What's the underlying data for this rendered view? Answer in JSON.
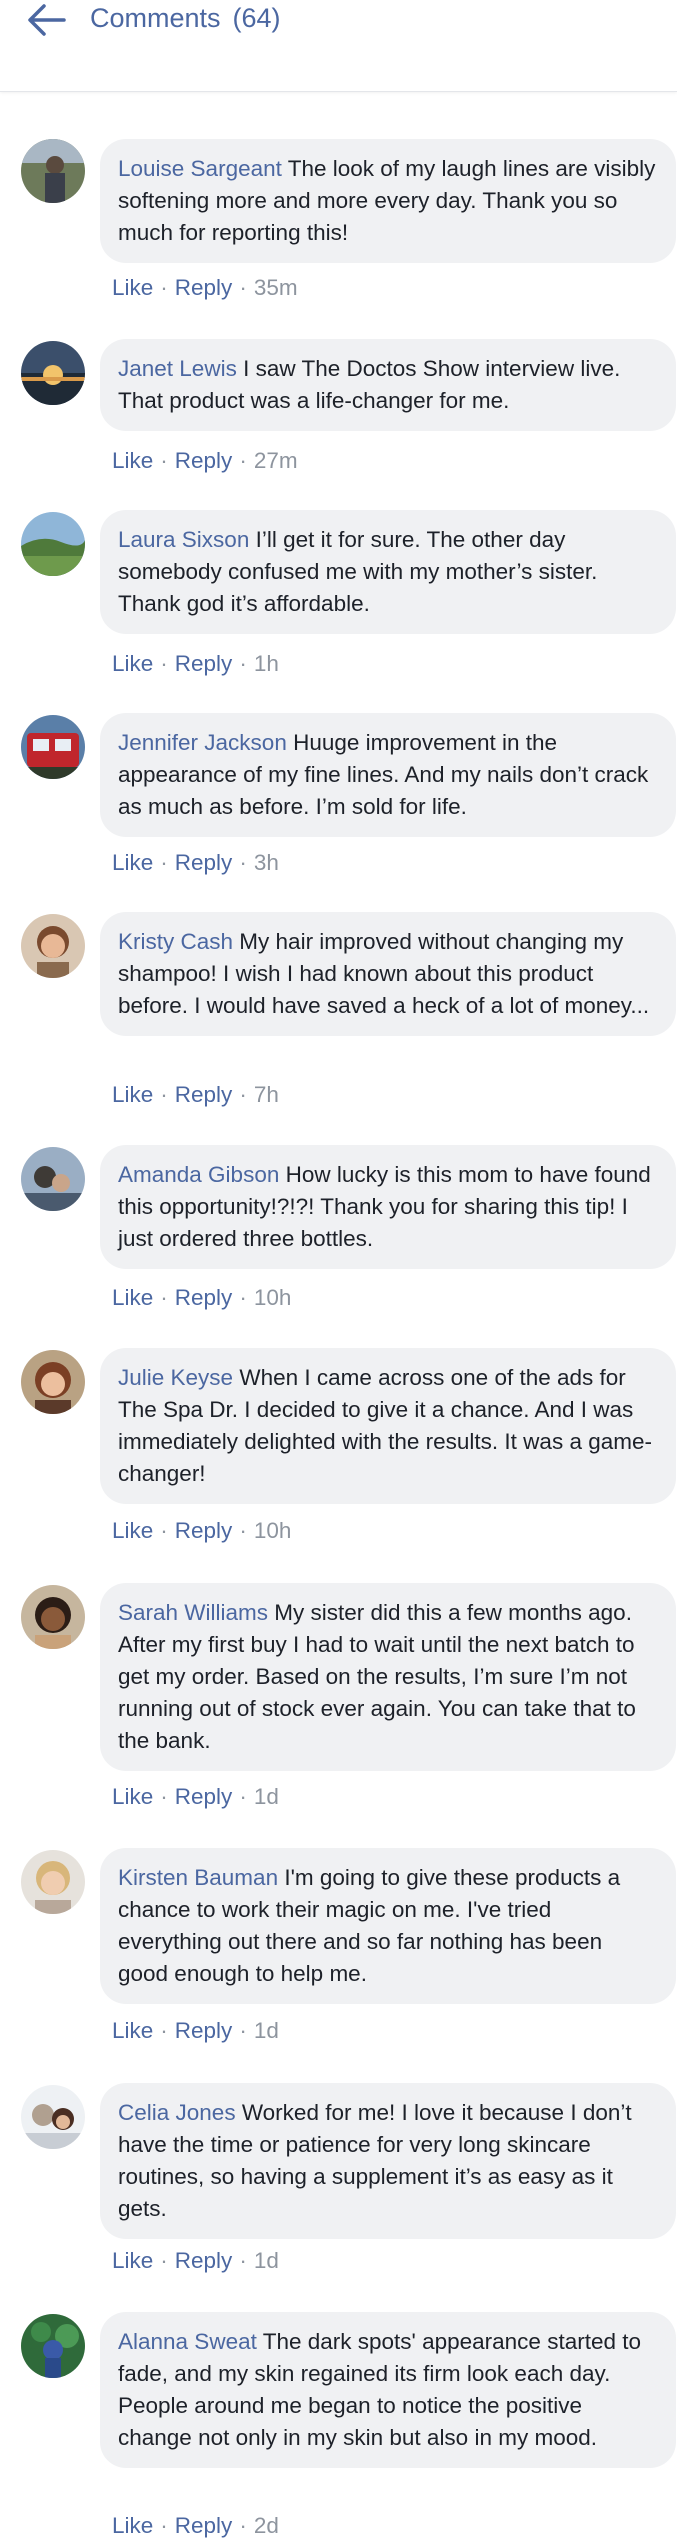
{
  "header": {
    "title": "Comments",
    "count": "(64)"
  },
  "actions": {
    "like": "Like",
    "reply": "Reply",
    "separator": "·"
  },
  "comments": [
    {
      "author": "Louise Sargeant",
      "text": "The look of my laugh lines are visibly softening more and more every day. Thank you so much for reporting this!",
      "time": "35m"
    },
    {
      "author": "Janet Lewis",
      "text": "I saw The Doctos Show interview live. That product was a life-changer for me.",
      "time": "27m"
    },
    {
      "author": "Laura Sixson",
      "text": "I’ll get it for sure. The other day somebody confused me with my mother’s sister. Thank god it’s affordable.",
      "time": "1h"
    },
    {
      "author": "Jennifer Jackson",
      "text": "Huuge improvement in the appearance of my fine lines. And my nails don’t crack as much as before. I’m sold for life.",
      "time": "3h"
    },
    {
      "author": "Kristy Cash",
      "text": "My hair improved without changing my shampoo! I wish I had known about this product before. I would have saved a heck of a lot of money...",
      "time": "7h"
    },
    {
      "author": "Amanda Gibson",
      "text": "How lucky is this mom to have found this opportunity!?!?! Thank you for sharing this tip! I just ordered three bottles.",
      "time": "10h"
    },
    {
      "author": "Julie Keyse",
      "text": "When I came across one of the ads for The Spa Dr. I decided to give it a chance. And I was immediately delighted with the results. It was a game-changer!",
      "time": "10h"
    },
    {
      "author": "Sarah Williams",
      "text": "My sister did this a few months ago. After my first buy I had to wait until the next batch to get my order. Based on the results, I’m sure I’m not running out of stock ever again. You can take that to the bank.",
      "time": "1d"
    },
    {
      "author": "Kirsten Bauman",
      "text": "I'm going to give these products a chance to work their magic on me. I've tried everything out there and so far nothing has been good enough to help me.",
      "time": "1d"
    },
    {
      "author": "Celia Jones",
      "text": "Worked for me! I love it because I don’t have the time or patience for very long skincare routines, so having a supplement it’s as easy as it gets.",
      "time": "1d"
    },
    {
      "author": "Alanna Sweat",
      "text": "The dark spots' appearance started to fade, and my skin regained its firm look each day. People around me began to notice the positive change not only in my skin but also in my mood.",
      "time": "2d"
    }
  ],
  "colors": {
    "link": "#4b67a1",
    "bubble": "#f0f1f3",
    "meta": "#8d949e"
  }
}
